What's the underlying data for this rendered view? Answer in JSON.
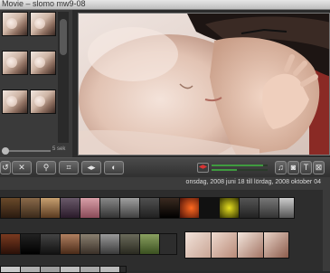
{
  "window": {
    "title": "Movie – slomo mw9-08"
  },
  "project_pane": {
    "thumbnail_rows": 3,
    "clip_length_label": "5 sek",
    "clip_length_fraction": 0.0
  },
  "viewer": {
    "description_icon": "baby-kiss-video-frame"
  },
  "toolbar": {
    "buttons": [
      {
        "name": "undo-button",
        "icon": "undo-icon",
        "glyph": "↺"
      },
      {
        "name": "reject-button",
        "icon": "x-icon",
        "glyph": "✕"
      },
      {
        "name": "keyword-button",
        "icon": "key-icon",
        "glyph": "⚲"
      },
      {
        "name": "crop-button",
        "icon": "crop-icon",
        "glyph": "⌗"
      },
      {
        "name": "audio-adjust-button",
        "icon": "audio-speaker-icon",
        "glyph": "◂▸"
      },
      {
        "name": "video-adjust-button",
        "icon": "contrast-icon",
        "glyph": "◐"
      }
    ],
    "audio_levels": [
      0.92,
      0.45
    ],
    "right_buttons": [
      {
        "name": "music-button",
        "icon": "music-note-icon",
        "glyph": "♫"
      },
      {
        "name": "photo-button",
        "icon": "camera-icon",
        "glyph": "◙"
      },
      {
        "name": "title-button",
        "icon": "title-t-icon",
        "glyph": "T"
      },
      {
        "name": "transition-button",
        "icon": "transition-icon",
        "glyph": "⊠"
      }
    ]
  },
  "event_browser": {
    "date_range": "onsdag, 2008 juni 18 till lördag, 2008 oktober 04"
  },
  "colors": {
    "background": "#2b2b2b",
    "toolbar": "#3e3e3e",
    "audio_meter": "#3f9a3f"
  }
}
